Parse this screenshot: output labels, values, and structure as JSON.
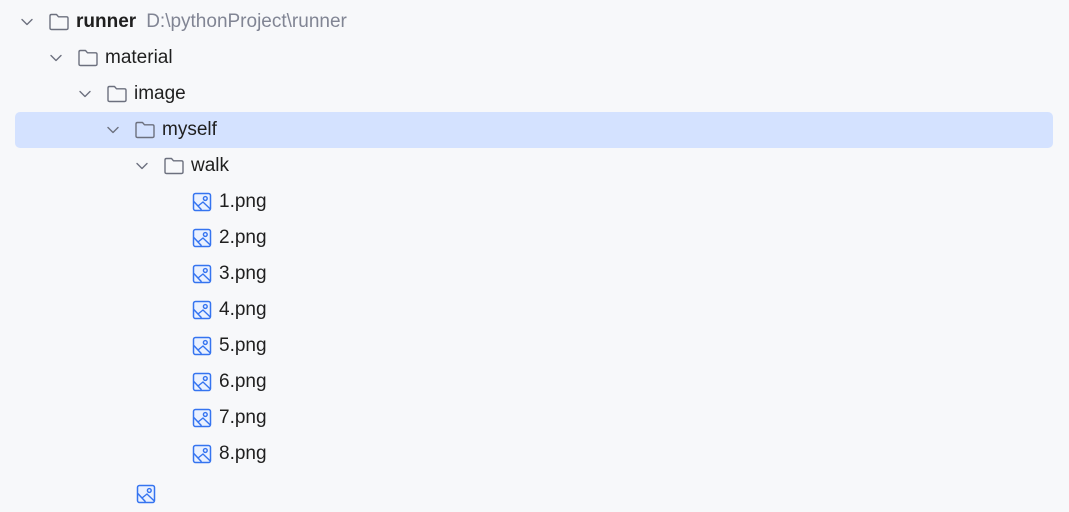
{
  "tree": {
    "root": {
      "label": "runner",
      "path": "D:\\pythonProject\\runner",
      "icon": "folder-icon"
    },
    "folders": [
      {
        "label": "material",
        "icon": "folder-icon"
      },
      {
        "label": "image",
        "icon": "folder-icon"
      },
      {
        "label": "myself",
        "icon": "folder-icon",
        "selected": true
      },
      {
        "label": "walk",
        "icon": "folder-icon"
      }
    ],
    "files": [
      {
        "label": "1.png",
        "icon": "image-icon"
      },
      {
        "label": "2.png",
        "icon": "image-icon"
      },
      {
        "label": "3.png",
        "icon": "image-icon"
      },
      {
        "label": "4.png",
        "icon": "image-icon"
      },
      {
        "label": "5.png",
        "icon": "image-icon"
      },
      {
        "label": "6.png",
        "icon": "image-icon"
      },
      {
        "label": "7.png",
        "icon": "image-icon"
      },
      {
        "label": "8.png",
        "icon": "image-icon"
      }
    ]
  },
  "colors": {
    "background": "#f7f8fa",
    "selection": "#d4e2ff",
    "image_icon": "#3574f0",
    "folder_icon": "#6c707e",
    "path_text": "#818594"
  }
}
